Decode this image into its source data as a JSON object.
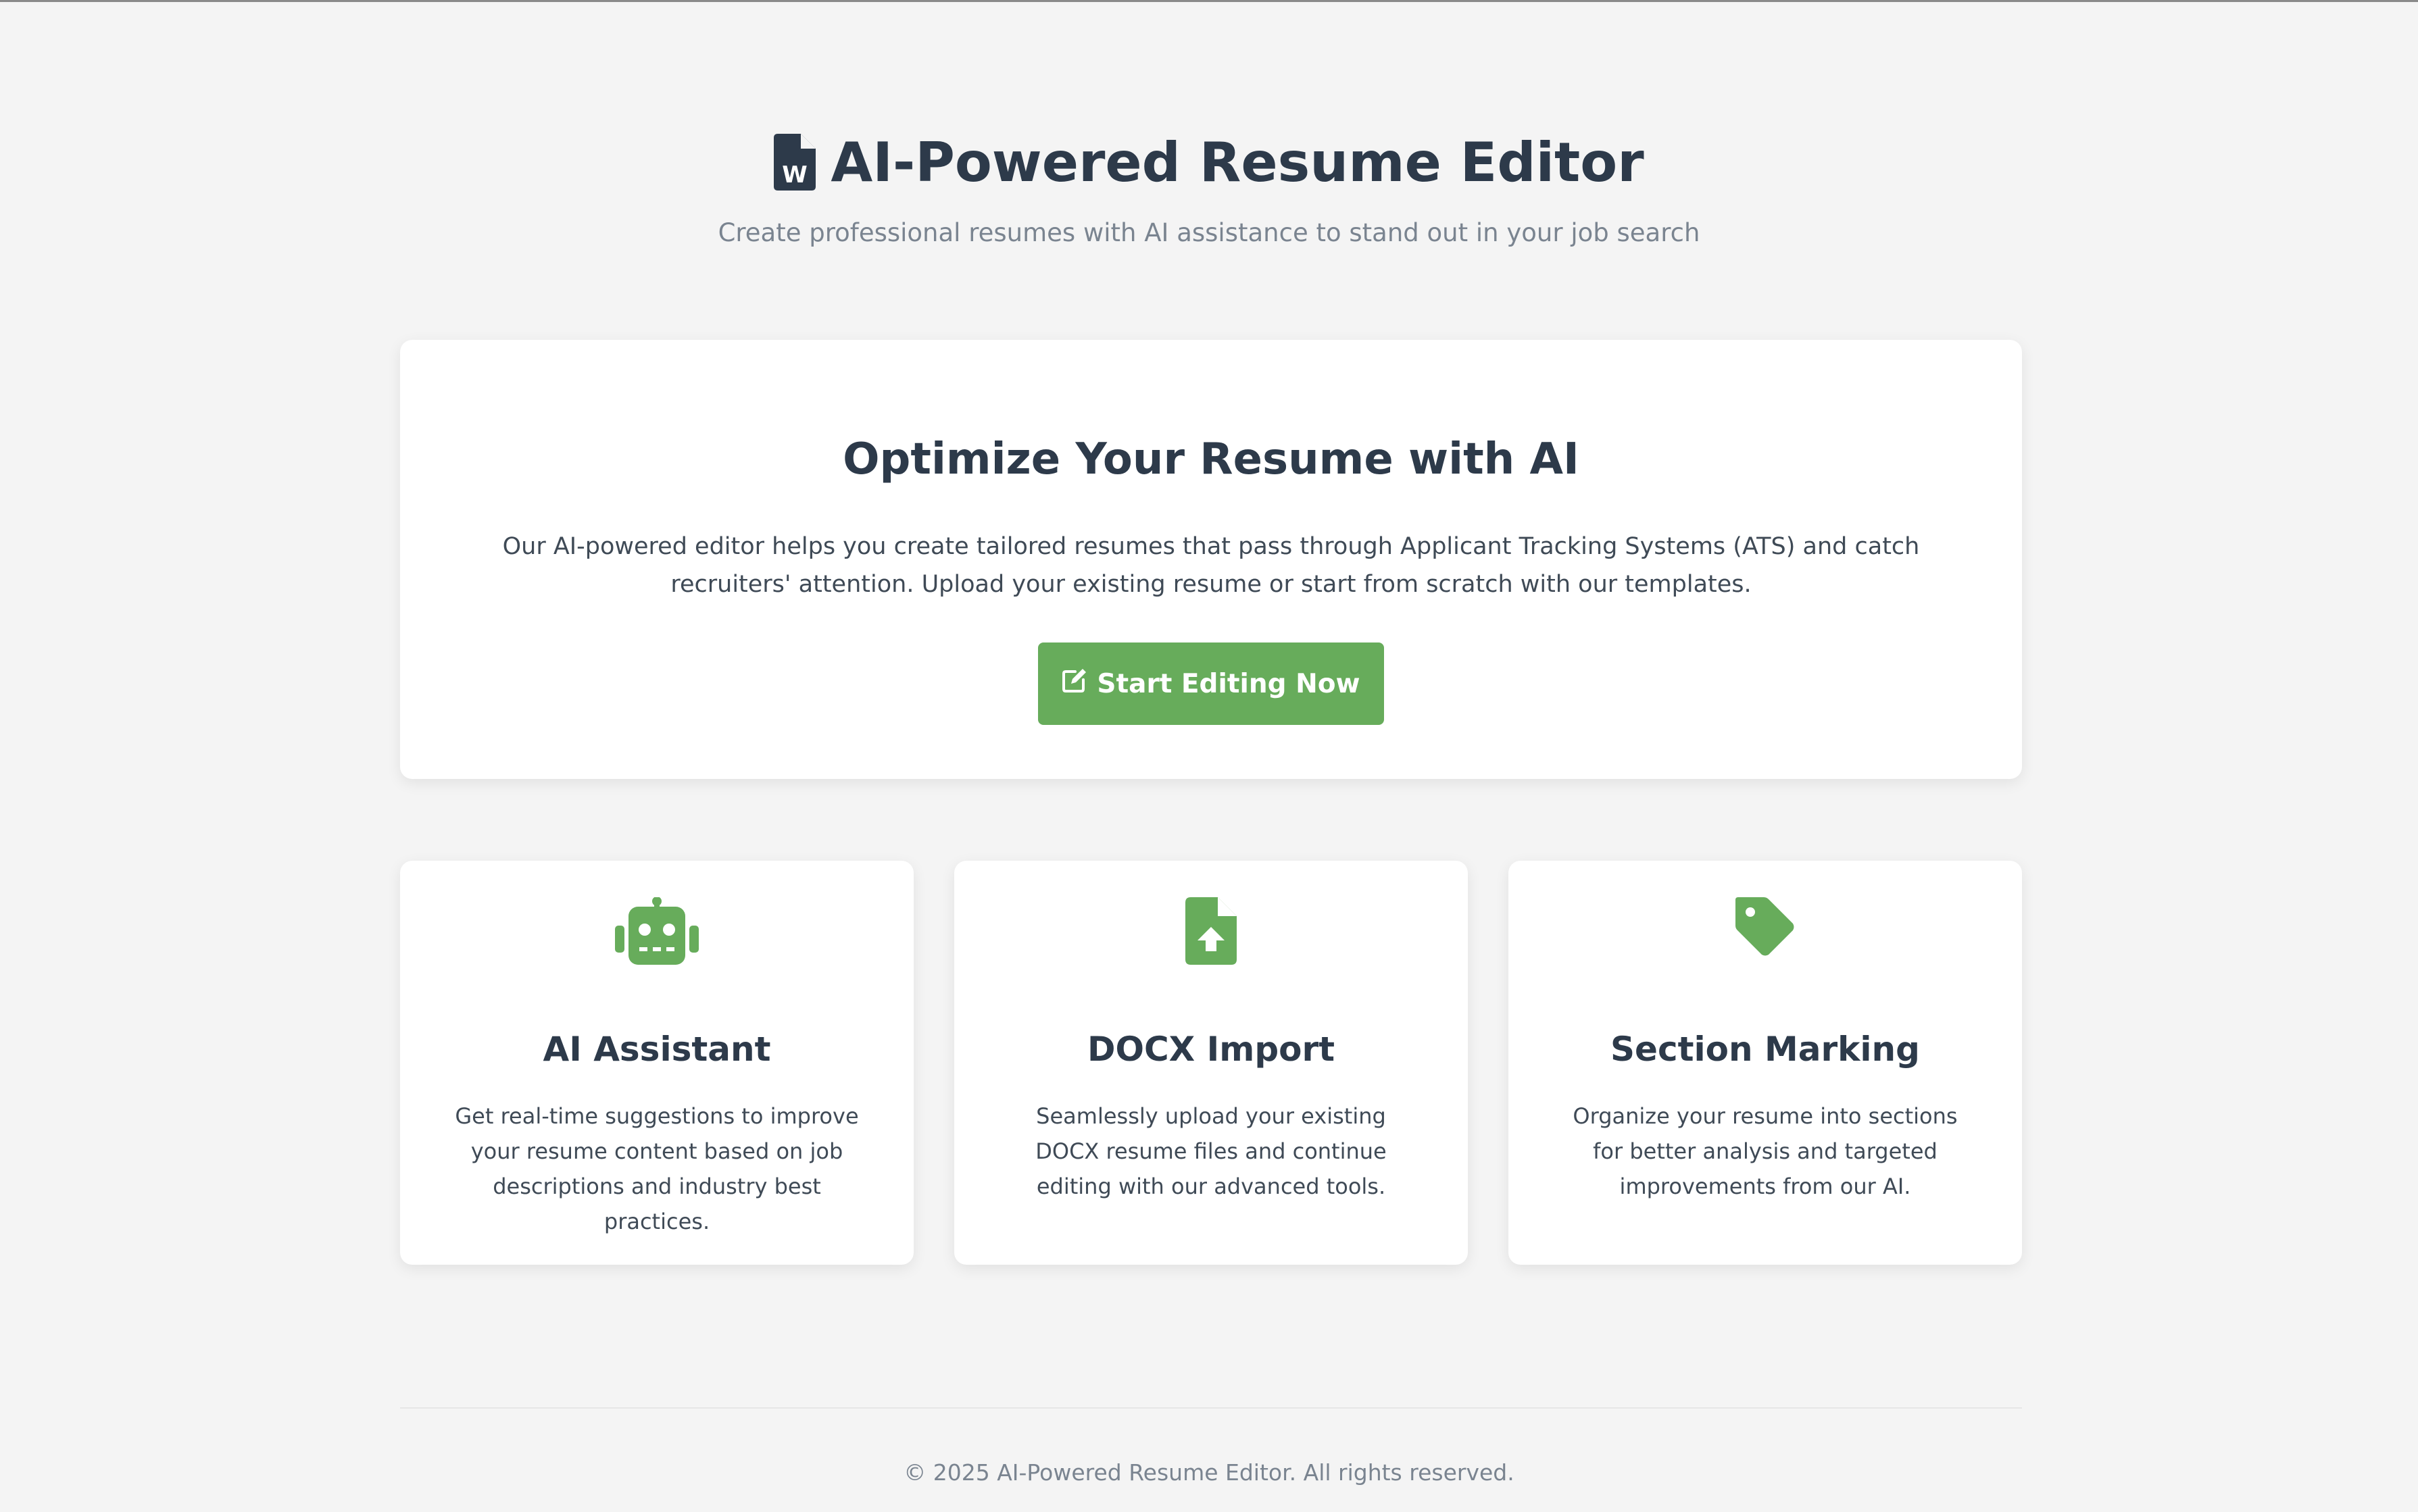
{
  "header": {
    "title": "AI-Powered Resume Editor",
    "subtitle": "Create professional resumes with AI assistance to stand out in your job search",
    "icon": "word-document-icon"
  },
  "hero": {
    "heading": "Optimize Your Resume with AI",
    "description": "Our AI-powered editor helps you create tailored resumes that pass through Applicant Tracking Systems (ATS) and catch recruiters' attention. Upload your existing resume or start from scratch with our templates.",
    "cta_label": "Start Editing Now",
    "cta_icon": "edit-icon"
  },
  "features": [
    {
      "icon": "robot-icon",
      "title": "AI Assistant",
      "description": "Get real-time suggestions to improve your resume content based on job descriptions and industry best practices."
    },
    {
      "icon": "file-upload-icon",
      "title": "DOCX Import",
      "description": "Seamlessly upload your existing DOCX resume files and continue editing with our advanced tools."
    },
    {
      "icon": "tag-icon",
      "title": "Section Marking",
      "description": "Organize your resume into sections for better analysis and targeted improvements from our AI."
    }
  ],
  "footer": {
    "text": "© 2025 AI-Powered Resume Editor. All rights reserved."
  },
  "colors": {
    "background": "#f4f4f4",
    "accent": "#67ac5b",
    "heading": "#2d3a4a",
    "muted": "#7a8490"
  }
}
